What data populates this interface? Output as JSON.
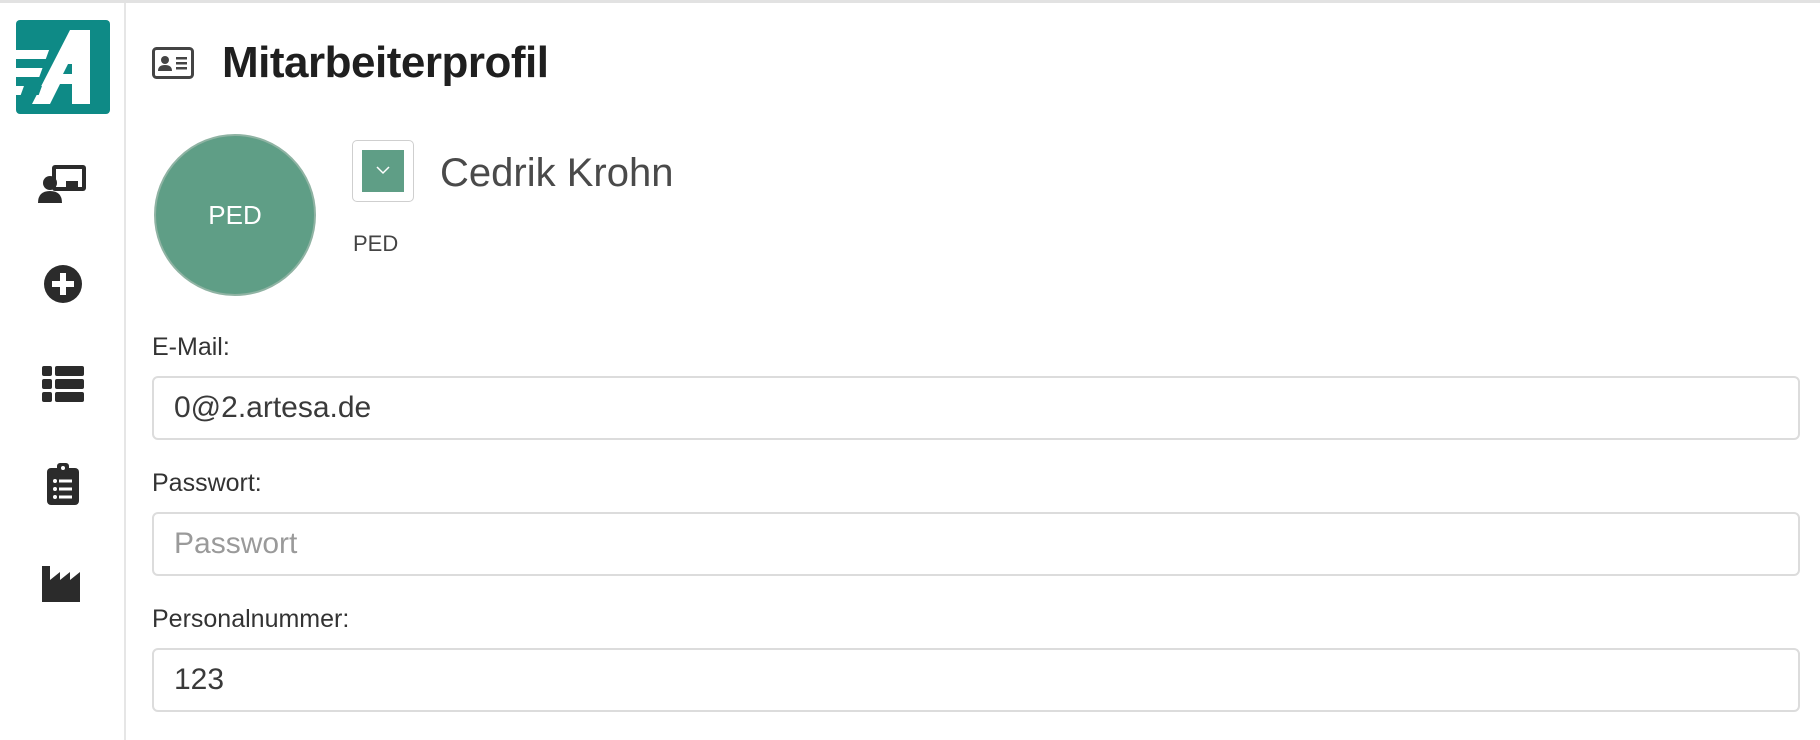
{
  "header": {
    "title": "Mitarbeiterprofil"
  },
  "sidebar": {
    "items": [
      {
        "icon": "presentation-user-icon"
      },
      {
        "icon": "plus-circle-icon"
      },
      {
        "icon": "list-icon"
      },
      {
        "icon": "clipboard-list-icon"
      },
      {
        "icon": "industry-icon"
      }
    ]
  },
  "profile": {
    "avatar_initials": "PED",
    "color_label": "PED",
    "name": "Cedrik Krohn",
    "color": "#5f9e86"
  },
  "form": {
    "email": {
      "label": "E-Mail:",
      "value": "0@2.artesa.de"
    },
    "password": {
      "label": "Passwort:",
      "placeholder": "Passwort",
      "value": ""
    },
    "personnel_number": {
      "label": "Personalnummer:",
      "value": "123"
    }
  },
  "colors": {
    "brand": "#0e8a86",
    "avatar": "#5f9e86"
  }
}
